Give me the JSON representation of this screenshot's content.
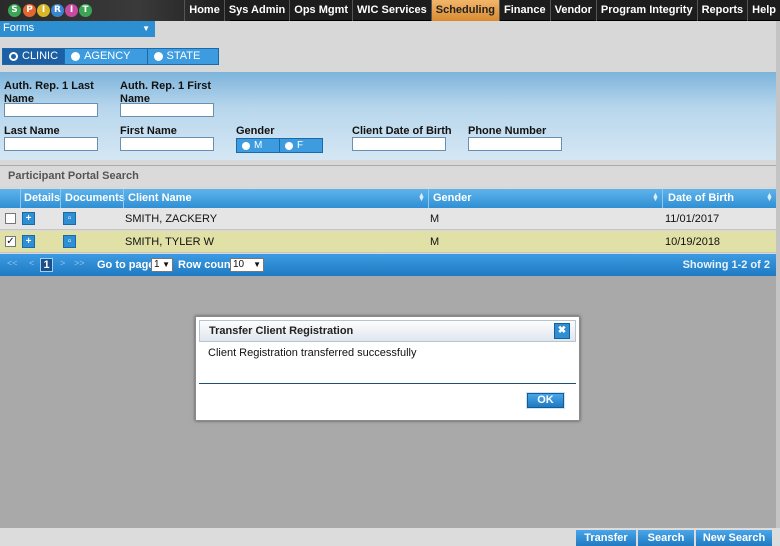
{
  "nav": {
    "items": [
      "Home",
      "Sys Admin",
      "Ops Mgmt",
      "WIC Services",
      "Scheduling",
      "Finance",
      "Vendor",
      "Program Integrity",
      "Reports",
      "Help"
    ],
    "active": "Scheduling"
  },
  "logo_letters": [
    "S",
    "P",
    "I",
    "R",
    "I",
    "T"
  ],
  "forms": {
    "label": "Forms"
  },
  "scope": {
    "options": [
      "CLINIC",
      "AGENCY",
      "STATE"
    ],
    "selected": "CLINIC"
  },
  "search": {
    "auth_last_label": "Auth. Rep. 1 Last Name",
    "auth_first_label": "Auth. Rep. 1 First Name",
    "last_name_label": "Last Name",
    "first_name_label": "First Name",
    "gender_label": "Gender",
    "gender_options": [
      "M",
      "F"
    ],
    "dob_label": "Client Date of Birth",
    "phone_label": "Phone Number",
    "auth_last_value": "",
    "auth_first_value": "",
    "last_name_value": "",
    "first_name_value": "",
    "dob_value": "",
    "phone_value": ""
  },
  "results": {
    "section_title": "Participant Portal Search",
    "columns": [
      "Details",
      "Documents",
      "Client Name",
      "Gender",
      "Date of Birth"
    ],
    "rows": [
      {
        "checked": false,
        "name": "SMITH, ZACKERY",
        "gender": "M",
        "dob": "11/01/2017"
      },
      {
        "checked": true,
        "name": "SMITH, TYLER W",
        "gender": "M",
        "dob": "10/19/2018"
      }
    ]
  },
  "pager": {
    "first": "<<",
    "prev": "<",
    "current_page": "1",
    "next": ">",
    "last": ">>",
    "goto_label": "Go to page:",
    "goto_value": "1",
    "rowcount_label": "Row count:",
    "rowcount_value": "10",
    "showing": "Showing 1-2 of 2"
  },
  "dialog": {
    "title": "Transfer Client Registration",
    "message": "Client Registration transferred successfully",
    "ok_label": "OK",
    "close_glyph": "✖"
  },
  "footer": {
    "transfer_label": "Transfer",
    "search_label": "Search",
    "new_search_label": "New Search"
  },
  "colors": {
    "accent": "#2f8fd3",
    "active_tab": "#e8a04c",
    "selected_row": "#e1e0a6"
  }
}
